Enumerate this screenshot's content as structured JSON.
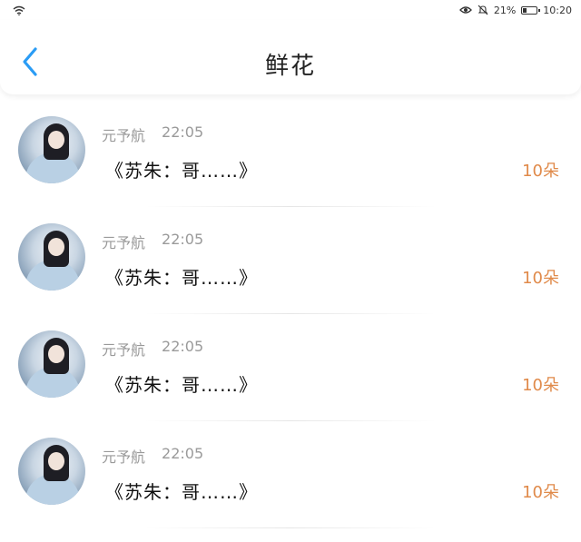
{
  "status_bar": {
    "battery_percent": "21%",
    "time": "10:20",
    "battery_level": 0.21
  },
  "header": {
    "title": "鲜花"
  },
  "colors": {
    "accent": "#2a9cf5",
    "count": "#e08a4a"
  },
  "items": [
    {
      "name": "元予航",
      "time": "22:05",
      "message": "《苏朱：哥……》",
      "count": "10朵"
    },
    {
      "name": "元予航",
      "time": "22:05",
      "message": "《苏朱：哥……》",
      "count": "10朵"
    },
    {
      "name": "元予航",
      "time": "22:05",
      "message": "《苏朱：哥……》",
      "count": "10朵"
    },
    {
      "name": "元予航",
      "time": "22:05",
      "message": "《苏朱：哥……》",
      "count": "10朵"
    }
  ]
}
